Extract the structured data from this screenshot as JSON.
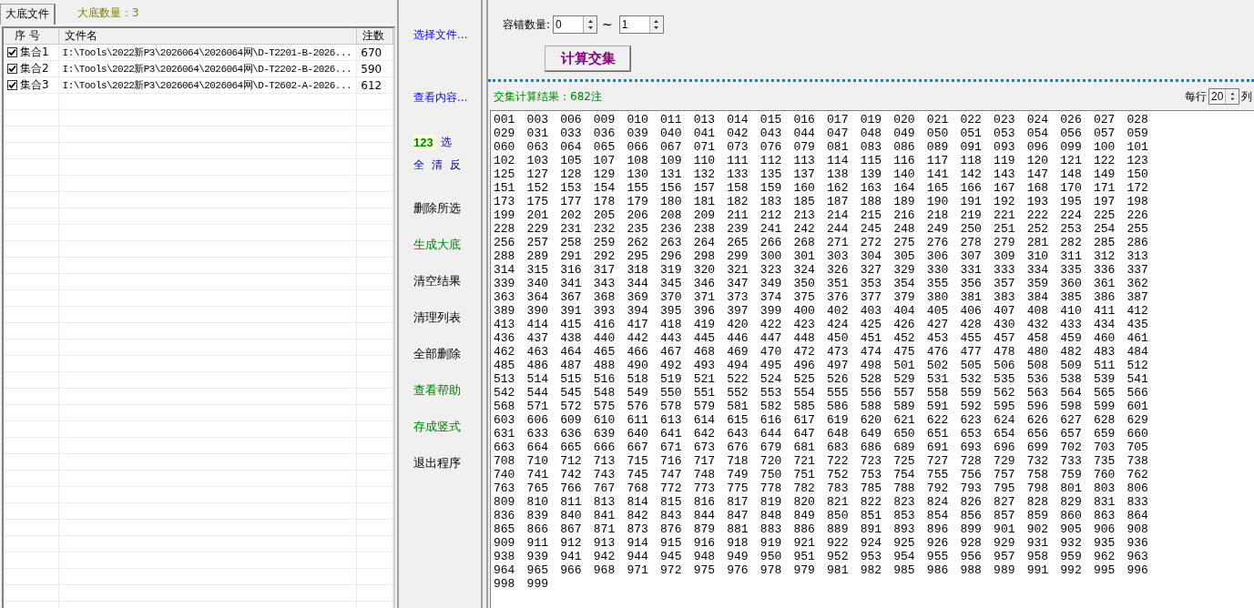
{
  "tabs": [
    {
      "label": "大底文件"
    }
  ],
  "base_count": "大底数量：3",
  "file_table": {
    "columns": [
      "序 号",
      "文件名",
      "注数"
    ],
    "rows": [
      {
        "set": "集合1",
        "checked": true,
        "file": "I:\\Tools\\2022新P3\\2026064\\2026064网\\D-T2201-B-2026...",
        "count": "670"
      },
      {
        "set": "集合2",
        "checked": true,
        "file": "I:\\Tools\\2022新P3\\2026064\\2026064网\\D-T2202-B-2026...",
        "count": "590"
      },
      {
        "set": "集合3",
        "checked": true,
        "file": "I:\\Tools\\2022新P3\\2026064\\2026064网\\D-T2602-A-2026...",
        "count": "612"
      }
    ]
  },
  "links": [
    "选择文件...",
    "查看内容..."
  ],
  "quick_select": {
    "badge": "123",
    "select": "选",
    "buttons": [
      "全",
      "清",
      "反"
    ]
  },
  "actions": [
    {
      "label": "删除所选",
      "kind": "plain"
    },
    {
      "label": "生成大底",
      "kind": "highlight"
    },
    {
      "label": "清空结果",
      "kind": "plain"
    },
    {
      "label": "清理列表",
      "kind": "plain"
    },
    {
      "label": "全部删除",
      "kind": "plain"
    },
    {
      "label": "查看帮助",
      "kind": "highlight"
    },
    {
      "label": "存成竖式",
      "kind": "highlight"
    },
    {
      "label": "退出程序",
      "kind": "plain"
    }
  ],
  "tolerance": {
    "label": "容错数量:",
    "from": "0",
    "separator": "~",
    "to": "1"
  },
  "compute_button": "计算交集",
  "result_label": "交集计算结果：682注",
  "per_row": {
    "label": "每行",
    "value": "20",
    "unit": "列"
  },
  "result_lines": [
    "001 003 006 009 010 011 013 014 015 016 017 019 020 021 022 023 024 026 027 028",
    "029 031 033 036 039 040 041 042 043 044 047 048 049 050 051 053 054 056 057 059",
    "060 063 064 065 066 067 071 073 076 079 081 083 086 089 091 093 096 099 100 101",
    "102 103 105 107 108 109 110 111 112 113 114 115 116 117 118 119 120 121 122 123",
    "125 127 128 129 130 131 132 133 135 137 138 139 140 141 142 143 147 148 149 150",
    "151 152 153 154 155 156 157 158 159 160 162 163 164 165 166 167 168 170 171 172",
    "173 175 177 178 179 180 181 182 183 185 187 188 189 190 191 192 193 195 197 198",
    "199 201 202 205 206 208 209 211 212 213 214 215 216 218 219 221 222 224 225 226",
    "228 229 231 232 235 236 238 239 241 242 244 245 248 249 250 251 252 253 254 255",
    "256 257 258 259 262 263 264 265 266 268 271 272 275 276 278 279 281 282 285 286",
    "288 289 291 292 295 296 298 299 300 301 303 304 305 306 307 309 310 311 312 313",
    "314 315 316 317 318 319 320 321 323 324 326 327 329 330 331 333 334 335 336 337",
    "339 340 341 343 344 345 346 347 349 350 351 353 354 355 356 357 359 360 361 362",
    "363 364 367 368 369 370 371 373 374 375 376 377 379 380 381 383 384 385 386 387",
    "389 390 391 393 394 395 396 397 399 400 402 403 404 405 406 407 408 410 411 412",
    "413 414 415 416 417 418 419 420 422 423 424 425 426 427 428 430 432 433 434 435",
    "436 437 438 440 442 443 445 446 447 448 450 451 452 453 455 457 458 459 460 461",
    "462 463 464 465 466 467 468 469 470 472 473 474 475 476 477 478 480 482 483 484",
    "485 486 487 488 490 492 493 494 495 496 497 498 501 502 505 506 508 509 511 512",
    "513 514 515 516 518 519 521 522 524 525 526 528 529 531 532 535 536 538 539 541",
    "542 544 545 548 549 550 551 552 553 554 555 556 557 558 559 562 563 564 565 566",
    "568 571 572 575 576 578 579 581 582 585 586 588 589 591 592 595 596 598 599 601",
    "603 606 609 610 611 613 614 615 616 617 619 620 621 622 623 624 626 627 628 629",
    "631 633 636 639 640 641 642 643 644 647 648 649 650 651 653 654 656 657 659 660",
    "663 664 665 666 667 671 673 676 679 681 683 686 689 691 693 696 699 702 703 705",
    "708 710 712 713 715 716 717 718 720 721 722 723 725 727 728 729 732 733 735 738",
    "740 741 742 743 745 747 748 749 750 751 752 753 754 755 756 757 758 759 760 762",
    "763 765 766 767 768 772 773 775 778 782 783 785 788 792 793 795 798 801 803 806",
    "809 810 811 813 814 815 816 817 819 820 821 822 823 824 826 827 828 829 831 833",
    "836 839 840 841 842 843 844 847 848 849 850 851 853 854 856 857 859 860 863 864",
    "865 866 867 871 873 876 879 881 883 886 889 891 893 896 899 901 902 905 906 908",
    "909 911 912 913 914 915 916 918 919 921 922 924 925 926 928 929 931 932 935 936",
    "938 939 941 942 944 945 948 949 950 951 952 953 954 955 956 957 958 959 962 963",
    "964 965 966 968 971 972 975 976 978 979 981 982 985 986 988 989 991 992 995 996",
    "998 999"
  ]
}
